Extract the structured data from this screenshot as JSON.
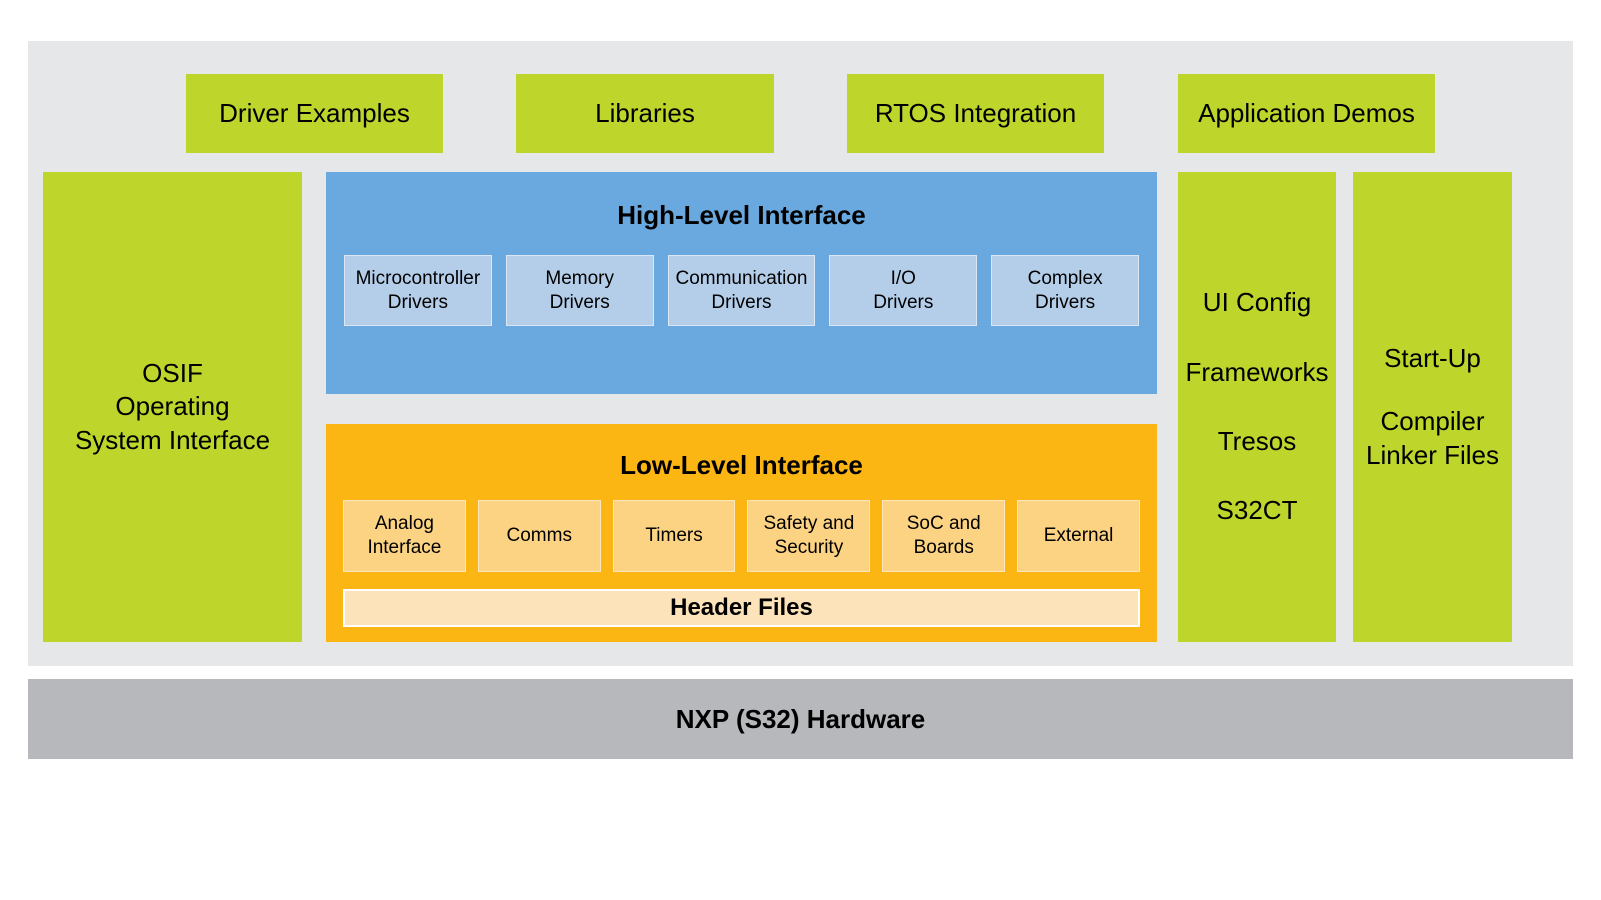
{
  "colors": {
    "panel_background": "#e6e7e8",
    "green": "#bed62b",
    "blue": "#6aa9df",
    "light_blue": "#b4cee9",
    "orange": "#fcb614",
    "light_orange": "#fcd383",
    "cream": "#fce3b9",
    "hardware_grey": "#b6b8bb",
    "text": "#000000"
  },
  "top_row": {
    "items": [
      {
        "label": "Driver Examples"
      },
      {
        "label": "Libraries"
      },
      {
        "label": "RTOS Integration"
      },
      {
        "label": "Application Demos"
      }
    ]
  },
  "osif": {
    "lines": [
      "OSIF",
      "Operating",
      "System Interface"
    ]
  },
  "high_level": {
    "title": "High-Level Interface",
    "items": [
      {
        "line1": "Microcontroller",
        "line2": "Drivers"
      },
      {
        "line1": "Memory",
        "line2": "Drivers"
      },
      {
        "line1": "Communication",
        "line2": "Drivers"
      },
      {
        "line1": "I/O",
        "line2": "Drivers"
      },
      {
        "line1": "Complex",
        "line2": "Drivers"
      }
    ]
  },
  "low_level": {
    "title": "Low-Level Interface",
    "items": [
      {
        "line1": "Analog",
        "line2": "Interface"
      },
      {
        "line1": "Comms",
        "line2": ""
      },
      {
        "line1": "Timers",
        "line2": ""
      },
      {
        "line1": "Safety and",
        "line2": "Security"
      },
      {
        "line1": "SoC and",
        "line2": "Boards"
      },
      {
        "line1": "External",
        "line2": ""
      }
    ],
    "header_files_label": "Header Files"
  },
  "config_column": {
    "lines": [
      "UI Config",
      "Frameworks",
      "Tresos",
      "S32CT"
    ]
  },
  "startup_column": {
    "lines": [
      "Start-Up",
      "Compiler",
      "Linker Files"
    ]
  },
  "hardware": {
    "label": "NXP (S32) Hardware"
  }
}
